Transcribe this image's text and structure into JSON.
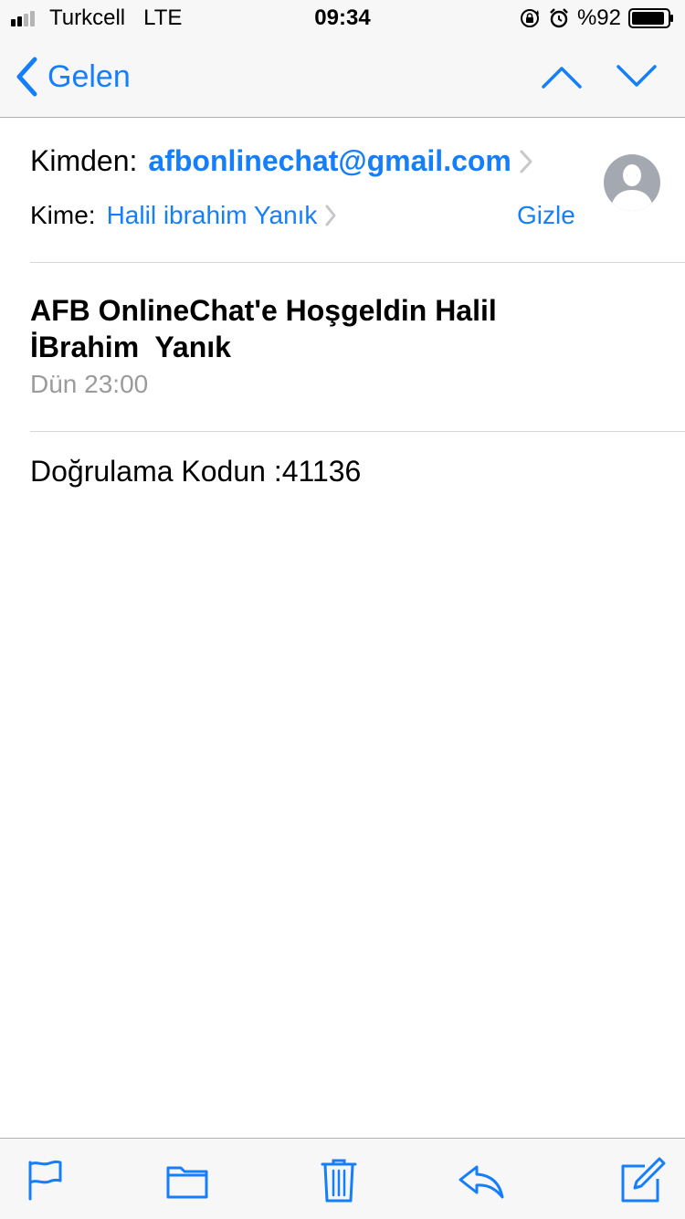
{
  "status_bar": {
    "carrier": "Turkcell",
    "network": "LTE",
    "time": "09:34",
    "battery": "%92",
    "battery_level": 0.92,
    "signal_bars_active": 2,
    "icons": [
      "signal-icon",
      "rotation-lock-icon",
      "alarm-icon",
      "battery-icon"
    ]
  },
  "nav": {
    "back_label": "Gelen",
    "icons": [
      "chevron-left-icon",
      "chevron-up-icon",
      "chevron-down-icon"
    ]
  },
  "header": {
    "from_label": "Kimden:",
    "from_value": "afbonlinechat@gmail.com",
    "to_label": "Kime:",
    "to_value": "Halil ibrahim Yanık",
    "hide_label": "Gizle"
  },
  "message": {
    "subject_line1": "AFB OnlineChat'e Hoşgeldin Halil",
    "subject_line2": "İBrahim  Yanık",
    "date": "Dün 23:00",
    "body": "Doğrulama Kodun :41136"
  },
  "toolbar": {
    "icons": [
      "flag-icon",
      "folder-icon",
      "trash-icon",
      "reply-icon",
      "compose-icon"
    ]
  },
  "colors": {
    "accent": "#147efb",
    "secondary_text": "#9b9b9b",
    "bar_background": "#f7f7f7"
  }
}
